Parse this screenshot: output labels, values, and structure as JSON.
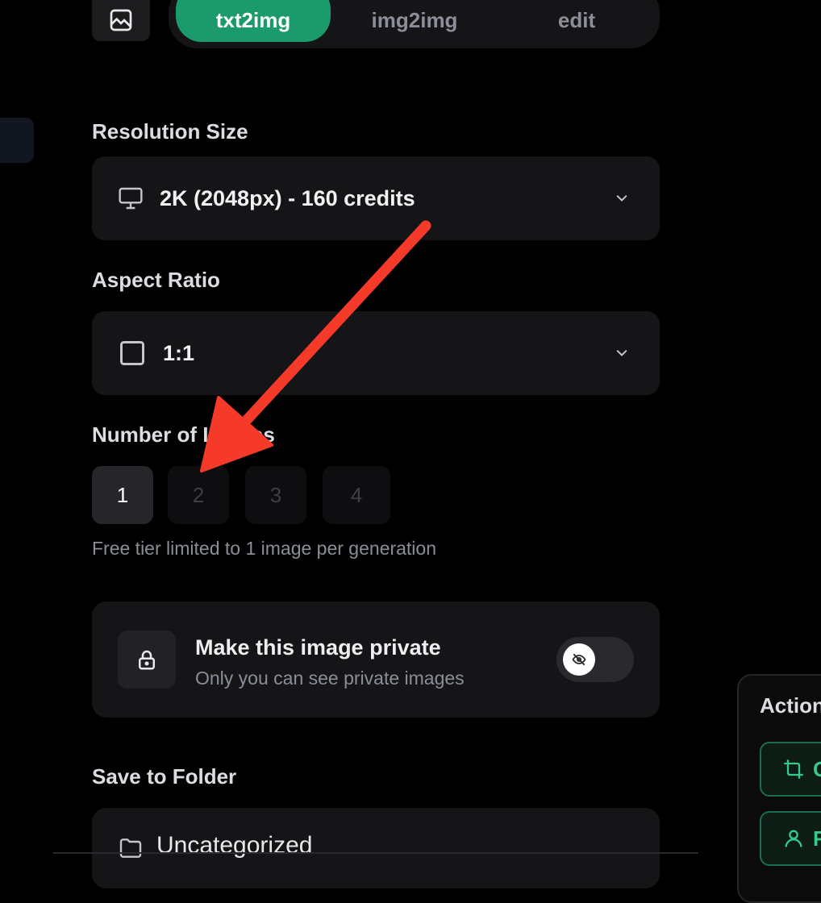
{
  "mode_tabs": {
    "image_icon": "image-icon",
    "items": [
      {
        "label": "txt2img",
        "active": true
      },
      {
        "label": "img2img",
        "active": false
      },
      {
        "label": "edit",
        "active": false
      }
    ]
  },
  "resolution": {
    "label": "Resolution Size",
    "value": "2K (2048px) - 160 credits",
    "icon": "monitor-icon"
  },
  "aspect": {
    "label": "Aspect Ratio",
    "value": "1:1",
    "icon": "square-icon"
  },
  "images": {
    "label": "Number of Images",
    "options": [
      "1",
      "2",
      "3",
      "4"
    ],
    "selected": "1",
    "note": "Free tier limited to 1 image per generation"
  },
  "privacy": {
    "title": "Make this image private",
    "subtitle": "Only you can see private images",
    "enabled": false
  },
  "folder": {
    "label": "Save to Folder",
    "value": "Uncategorized"
  },
  "actions": {
    "title": "Actions",
    "buttons": [
      {
        "label": "C",
        "icon": "crop-icon"
      },
      {
        "label": "F",
        "icon": "user-icon"
      }
    ]
  },
  "colors": {
    "accent": "#1b9a6b",
    "annotation_arrow": "#f53a2a",
    "background": "#000000"
  }
}
